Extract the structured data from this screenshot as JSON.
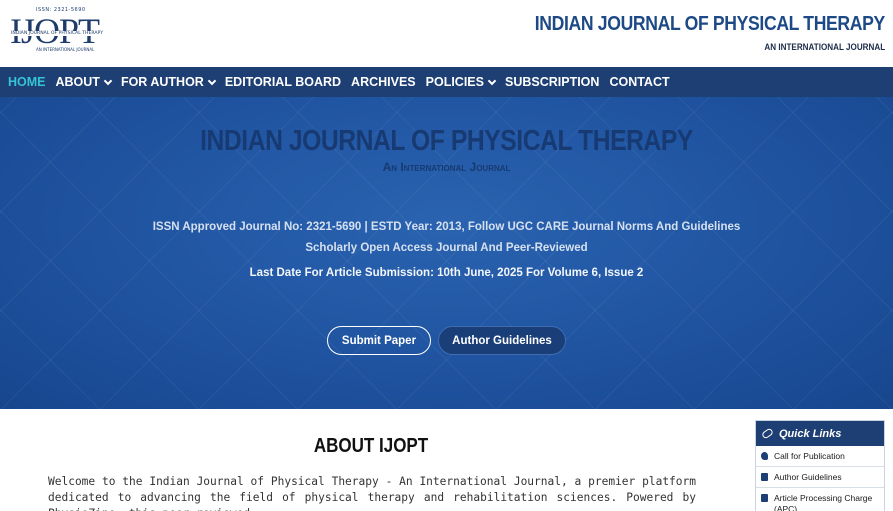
{
  "logo": {
    "issn": "ISSN: 2321-5690",
    "mark": "IJOPT",
    "small_name": "INDIAN JOURNAL OF PHYSICAL THERAPY",
    "small_sub": "AN INTERNATIONAL JOURNAL"
  },
  "header": {
    "title": "INDIAN JOURNAL OF PHYSICAL THERAPY",
    "subtitle": "AN INTERNATIONAL JOURNAL"
  },
  "nav": {
    "items": [
      {
        "label": "HOME",
        "active": true,
        "dropdown": false
      },
      {
        "label": "ABOUT",
        "active": false,
        "dropdown": true
      },
      {
        "label": "FOR AUTHOR",
        "active": false,
        "dropdown": true
      },
      {
        "label": "EDITORIAL BOARD",
        "active": false,
        "dropdown": false
      },
      {
        "label": "ARCHIVES",
        "active": false,
        "dropdown": false
      },
      {
        "label": "POLICIES",
        "active": false,
        "dropdown": true
      },
      {
        "label": "SUBSCRIPTION",
        "active": false,
        "dropdown": false
      },
      {
        "label": "CONTACT",
        "active": false,
        "dropdown": false
      }
    ]
  },
  "hero": {
    "title": "INDIAN JOURNAL OF PHYSICAL THERAPY",
    "subtitle": "An International Journal",
    "line1": "ISSN Approved Journal No: 2321-5690 | ESTD Year: 2013, Follow UGC CARE Journal Norms And Guidelines",
    "line2": "Scholarly Open Access Journal And Peer-Reviewed",
    "line3": "Last Date For Article Submission: 10th June, 2025 For Volume 6, Issue 2",
    "submit_label": "Submit Paper",
    "guidelines_label": "Author Guidelines"
  },
  "about": {
    "title": "ABOUT IJOPT",
    "text": "Welcome to the Indian Journal of Physical Therapy - An International Journal, a premier platform dedicated to advancing the field of physical therapy and rehabilitation sciences. Powered by PhysioZine, this peer-reviewed"
  },
  "quick_links": {
    "title": "Quick Links",
    "items": [
      {
        "label": "Call for Publication",
        "icon": "phone-icon"
      },
      {
        "label": "Author Guidelines",
        "icon": "document-icon"
      },
      {
        "label": "Article Processing Charge (APC)",
        "icon": "payment-icon"
      }
    ]
  },
  "colors": {
    "nav_bg": "#1e3f74",
    "nav_active": "#35c3d8",
    "hero_bg": "#1f53a0",
    "brand": "#1d4a86"
  }
}
